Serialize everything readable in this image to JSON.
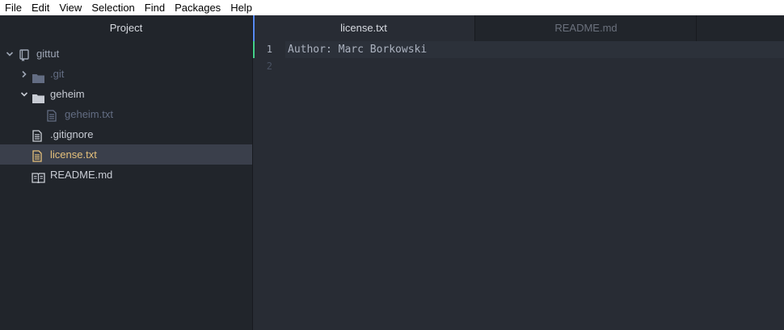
{
  "menubar": {
    "items": [
      "File",
      "Edit",
      "View",
      "Selection",
      "Find",
      "Packages",
      "Help"
    ]
  },
  "sidebar": {
    "header": "Project",
    "tree": [
      {
        "label": "gittut",
        "icon": "repo-icon",
        "expanded": true
      },
      {
        "label": ".git",
        "icon": "folder-icon",
        "expanded": false
      },
      {
        "label": "geheim",
        "icon": "folder-icon",
        "expanded": true
      },
      {
        "label": "geheim.txt",
        "icon": "file-text-icon"
      },
      {
        "label": ".gitignore",
        "icon": "file-text-icon"
      },
      {
        "label": "license.txt",
        "icon": "file-text-icon",
        "selected": true
      },
      {
        "label": "README.md",
        "icon": "book-icon"
      }
    ]
  },
  "tabs": [
    {
      "label": "license.txt",
      "active": true
    },
    {
      "label": "README.md",
      "active": false
    }
  ],
  "editor": {
    "line_numbers": [
      "1",
      "2"
    ],
    "lines": [
      "Author: Marc Borkowski",
      ""
    ]
  },
  "colors": {
    "accent": "#568af2",
    "selected_file": "#e5c07b",
    "ignored": "#636d83",
    "modified_marker": "#43d08a"
  }
}
